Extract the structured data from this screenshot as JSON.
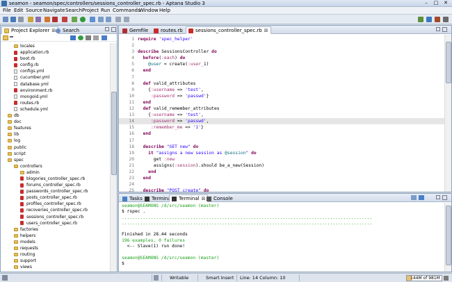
{
  "window": {
    "title": "seamon - seamon/spec/controllers/sessions_controller_spec.rb - Aptana Studio 3"
  },
  "menu": [
    "File",
    "Edit",
    "Source",
    "Navigate",
    "Search",
    "Project",
    "Run",
    "Commands",
    "Window",
    "Help"
  ],
  "left_view": {
    "tabs": [
      {
        "label": "Project Explorer",
        "close": "⊠"
      },
      {
        "label": "Search"
      }
    ],
    "tree": [
      {
        "label": "locales",
        "type": "folder",
        "indent": 3
      },
      {
        "label": "application.rb",
        "type": "rb",
        "indent": 3
      },
      {
        "label": "boot.rb",
        "type": "rb",
        "indent": 3
      },
      {
        "label": "config.rb",
        "type": "rb",
        "indent": 3
      },
      {
        "label": "configs.yml",
        "type": "yml",
        "indent": 3
      },
      {
        "label": "cucumber.yml",
        "type": "yml",
        "indent": 3
      },
      {
        "label": "database.yml",
        "type": "yml",
        "indent": 3
      },
      {
        "label": "environment.rb",
        "type": "rb",
        "indent": 3
      },
      {
        "label": "mongoid.yml",
        "type": "yml",
        "indent": 3
      },
      {
        "label": "routes.rb",
        "type": "rb",
        "indent": 3
      },
      {
        "label": "schedule.yml",
        "type": "yml",
        "indent": 3
      },
      {
        "label": "db",
        "type": "folder",
        "indent": 2
      },
      {
        "label": "doc",
        "type": "folder",
        "indent": 2
      },
      {
        "label": "features",
        "type": "folder",
        "indent": 2
      },
      {
        "label": "lib",
        "type": "folder",
        "indent": 2
      },
      {
        "label": "log",
        "type": "folder",
        "indent": 2
      },
      {
        "label": "public",
        "type": "folder",
        "indent": 2
      },
      {
        "label": "script",
        "type": "folder",
        "indent": 2
      },
      {
        "label": "spec",
        "type": "folder",
        "indent": 2
      },
      {
        "label": "controllers",
        "type": "folder",
        "indent": 3
      },
      {
        "label": "admin",
        "type": "folder",
        "indent": 4
      },
      {
        "label": "blogories_controller_spec.rb",
        "type": "rb",
        "indent": 4
      },
      {
        "label": "forums_controller_spec.rb",
        "type": "rb",
        "indent": 4
      },
      {
        "label": "passwords_controller_spec.rb",
        "type": "rb",
        "indent": 4
      },
      {
        "label": "posts_controller_spec.rb",
        "type": "rb",
        "indent": 4
      },
      {
        "label": "profiles_controller_spec.rb",
        "type": "rb",
        "indent": 4
      },
      {
        "label": "recoveries_controller_spec.rb",
        "type": "rb",
        "indent": 4
      },
      {
        "label": "sessions_controller_spec.rb",
        "type": "rb",
        "indent": 4
      },
      {
        "label": "users_controller_spec.rb",
        "type": "rb",
        "indent": 4
      },
      {
        "label": "factories",
        "type": "folder",
        "indent": 3
      },
      {
        "label": "helpers",
        "type": "folder",
        "indent": 3
      },
      {
        "label": "models",
        "type": "folder",
        "indent": 3
      },
      {
        "label": "requests",
        "type": "folder",
        "indent": 3
      },
      {
        "label": "routing",
        "type": "folder",
        "indent": 3
      },
      {
        "label": "support",
        "type": "folder",
        "indent": 3
      },
      {
        "label": "views",
        "type": "folder",
        "indent": 3
      }
    ]
  },
  "editor": {
    "tabs": [
      "Gemfile",
      "routes.rb",
      "sessions_controller_spec.rb"
    ],
    "lines": [
      {
        "n": "1",
        "t": "require 'spec_helper'"
      },
      {
        "n": "2",
        "t": ""
      },
      {
        "n": "3",
        "t": "describe SessionsController do"
      },
      {
        "n": "4",
        "t": "  before(:each) do"
      },
      {
        "n": "5",
        "t": "    @user = create(:user_1)"
      },
      {
        "n": "6",
        "t": "  end"
      },
      {
        "n": "7",
        "t": ""
      },
      {
        "n": "8",
        "t": "  def valid_attributes"
      },
      {
        "n": "9",
        "t": "    {:username => 'test',"
      },
      {
        "n": "10",
        "t": "     :password => 'passwd'}"
      },
      {
        "n": "11",
        "t": "  end"
      },
      {
        "n": "12",
        "t": "  def valid_remember_attributes"
      },
      {
        "n": "13",
        "t": "    {:username => 'test',"
      },
      {
        "n": "14",
        "t": "     :password => 'passwd',"
      },
      {
        "n": "15",
        "t": "     :remember_me => '1'}"
      },
      {
        "n": "16",
        "t": "  end"
      },
      {
        "n": "17",
        "t": ""
      },
      {
        "n": "18",
        "t": "  describe \"GET new\" do"
      },
      {
        "n": "19",
        "t": "    it \"assigns a new session as @session\" do"
      },
      {
        "n": "20",
        "t": "      get :new"
      },
      {
        "n": "21",
        "t": "      assigns(:session).should be_a_new(Session)"
      },
      {
        "n": "22",
        "t": "    end"
      },
      {
        "n": "23",
        "t": "  end"
      },
      {
        "n": "24",
        "t": ""
      },
      {
        "n": "25",
        "t": "  describe \"POST create\" do"
      }
    ]
  },
  "console": {
    "tabs": [
      "Tasks",
      "Terminal",
      "Terminal",
      "Console"
    ],
    "lines": [
      {
        "t": "seamon@SEAMONS /d/src/seamon (master)",
        "c": "green"
      },
      {
        "t": "$ rspec .",
        "c": ""
      },
      {
        "t": "...............................................................................................",
        "c": "green"
      },
      {
        "t": "...............................................................................................",
        "c": "green"
      },
      {
        "t": "",
        "c": ""
      },
      {
        "t": "Finished in 28.44 seconds",
        "c": ""
      },
      {
        "t": "196 examples, 0 failures",
        "c": "green"
      },
      {
        "t": "  <-- Slave(1) run done!",
        "c": ""
      },
      {
        "t": "",
        "c": ""
      },
      {
        "t": "seamon@SEAMONS /d/src/seamon (master)",
        "c": "green"
      },
      {
        "t": "$",
        "c": ""
      }
    ]
  },
  "status": {
    "mode": "Writable",
    "insert": "Smart Insert",
    "position": "Line: 14 Column: 10",
    "memory": "144M of 981M"
  }
}
